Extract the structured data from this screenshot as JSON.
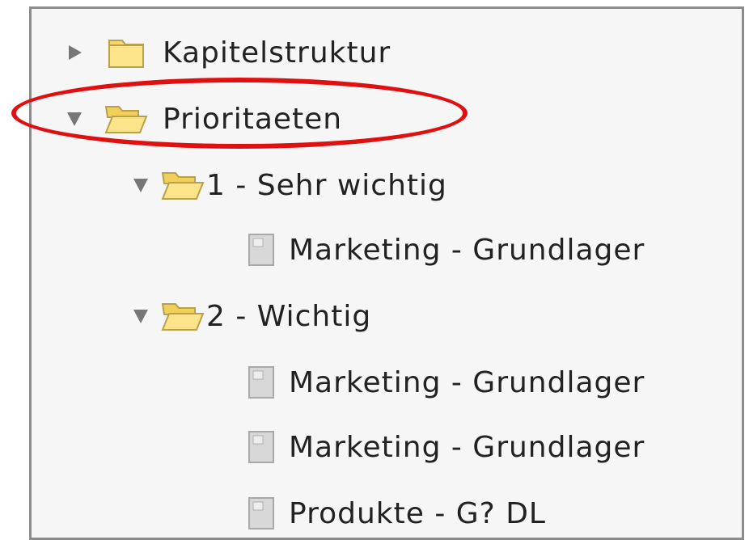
{
  "tree": {
    "items": [
      {
        "label": "Kapitelstruktur",
        "type": "folder",
        "state": "collapsed",
        "level": 0
      },
      {
        "label": "Prioritaeten",
        "type": "folder",
        "state": "expanded",
        "level": 0
      },
      {
        "label": "1 - Sehr wichtig",
        "type": "folder",
        "state": "expanded",
        "level": 1
      },
      {
        "label": "Marketing - Grundlager",
        "type": "document",
        "level": 2
      },
      {
        "label": "2 - Wichtig",
        "type": "folder",
        "state": "expanded",
        "level": 1
      },
      {
        "label": "Marketing - Grundlager",
        "type": "document",
        "level": 2
      },
      {
        "label": "Marketing - Grundlager",
        "type": "document",
        "level": 2
      },
      {
        "label": "Produkte - G? DL",
        "type": "document",
        "level": 2
      }
    ]
  },
  "colors": {
    "highlight_ring": "#e01010",
    "folder_fill": "#f7d96a",
    "expander": "#777777",
    "document_icon": "#b8b8b8"
  },
  "icons": {
    "collapsed_expander": "triangle-right-icon",
    "expanded_expander": "triangle-down-icon",
    "closed_folder": "folder-icon",
    "open_folder": "folder-open-icon",
    "document": "document-icon"
  }
}
